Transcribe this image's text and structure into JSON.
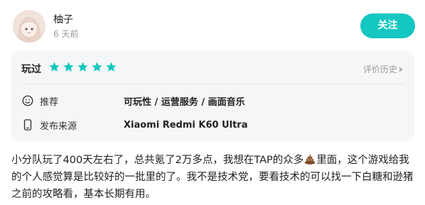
{
  "user": {
    "name": "柚子",
    "time": "6 天前"
  },
  "follow_label": "关注",
  "rating": {
    "played_label": "玩过",
    "stars": 5,
    "max_stars": 5,
    "history_label": "评价历史"
  },
  "tags": {
    "label": "推荐",
    "value": "可玩性 / 运营服务 / 画面音乐"
  },
  "device": {
    "label": "发布来源",
    "value": "Xiaomi Redmi K60 Ultra"
  },
  "review": {
    "part1": "小分队玩了400天左右了，总共氪了2万多点，我想在TAP的众多",
    "emoji_icon": "poop-icon",
    "part2": "里面，这个游戏给我的个人感觉算是比较好的一批里的了。我不是技术党，要看技术的可以找一下白糖和逊猪之前的攻略看，基本长期有用。"
  },
  "colors": {
    "accent": "#14c7c0",
    "star": "#14c7c0",
    "card_bg": "#f5f6f7"
  }
}
